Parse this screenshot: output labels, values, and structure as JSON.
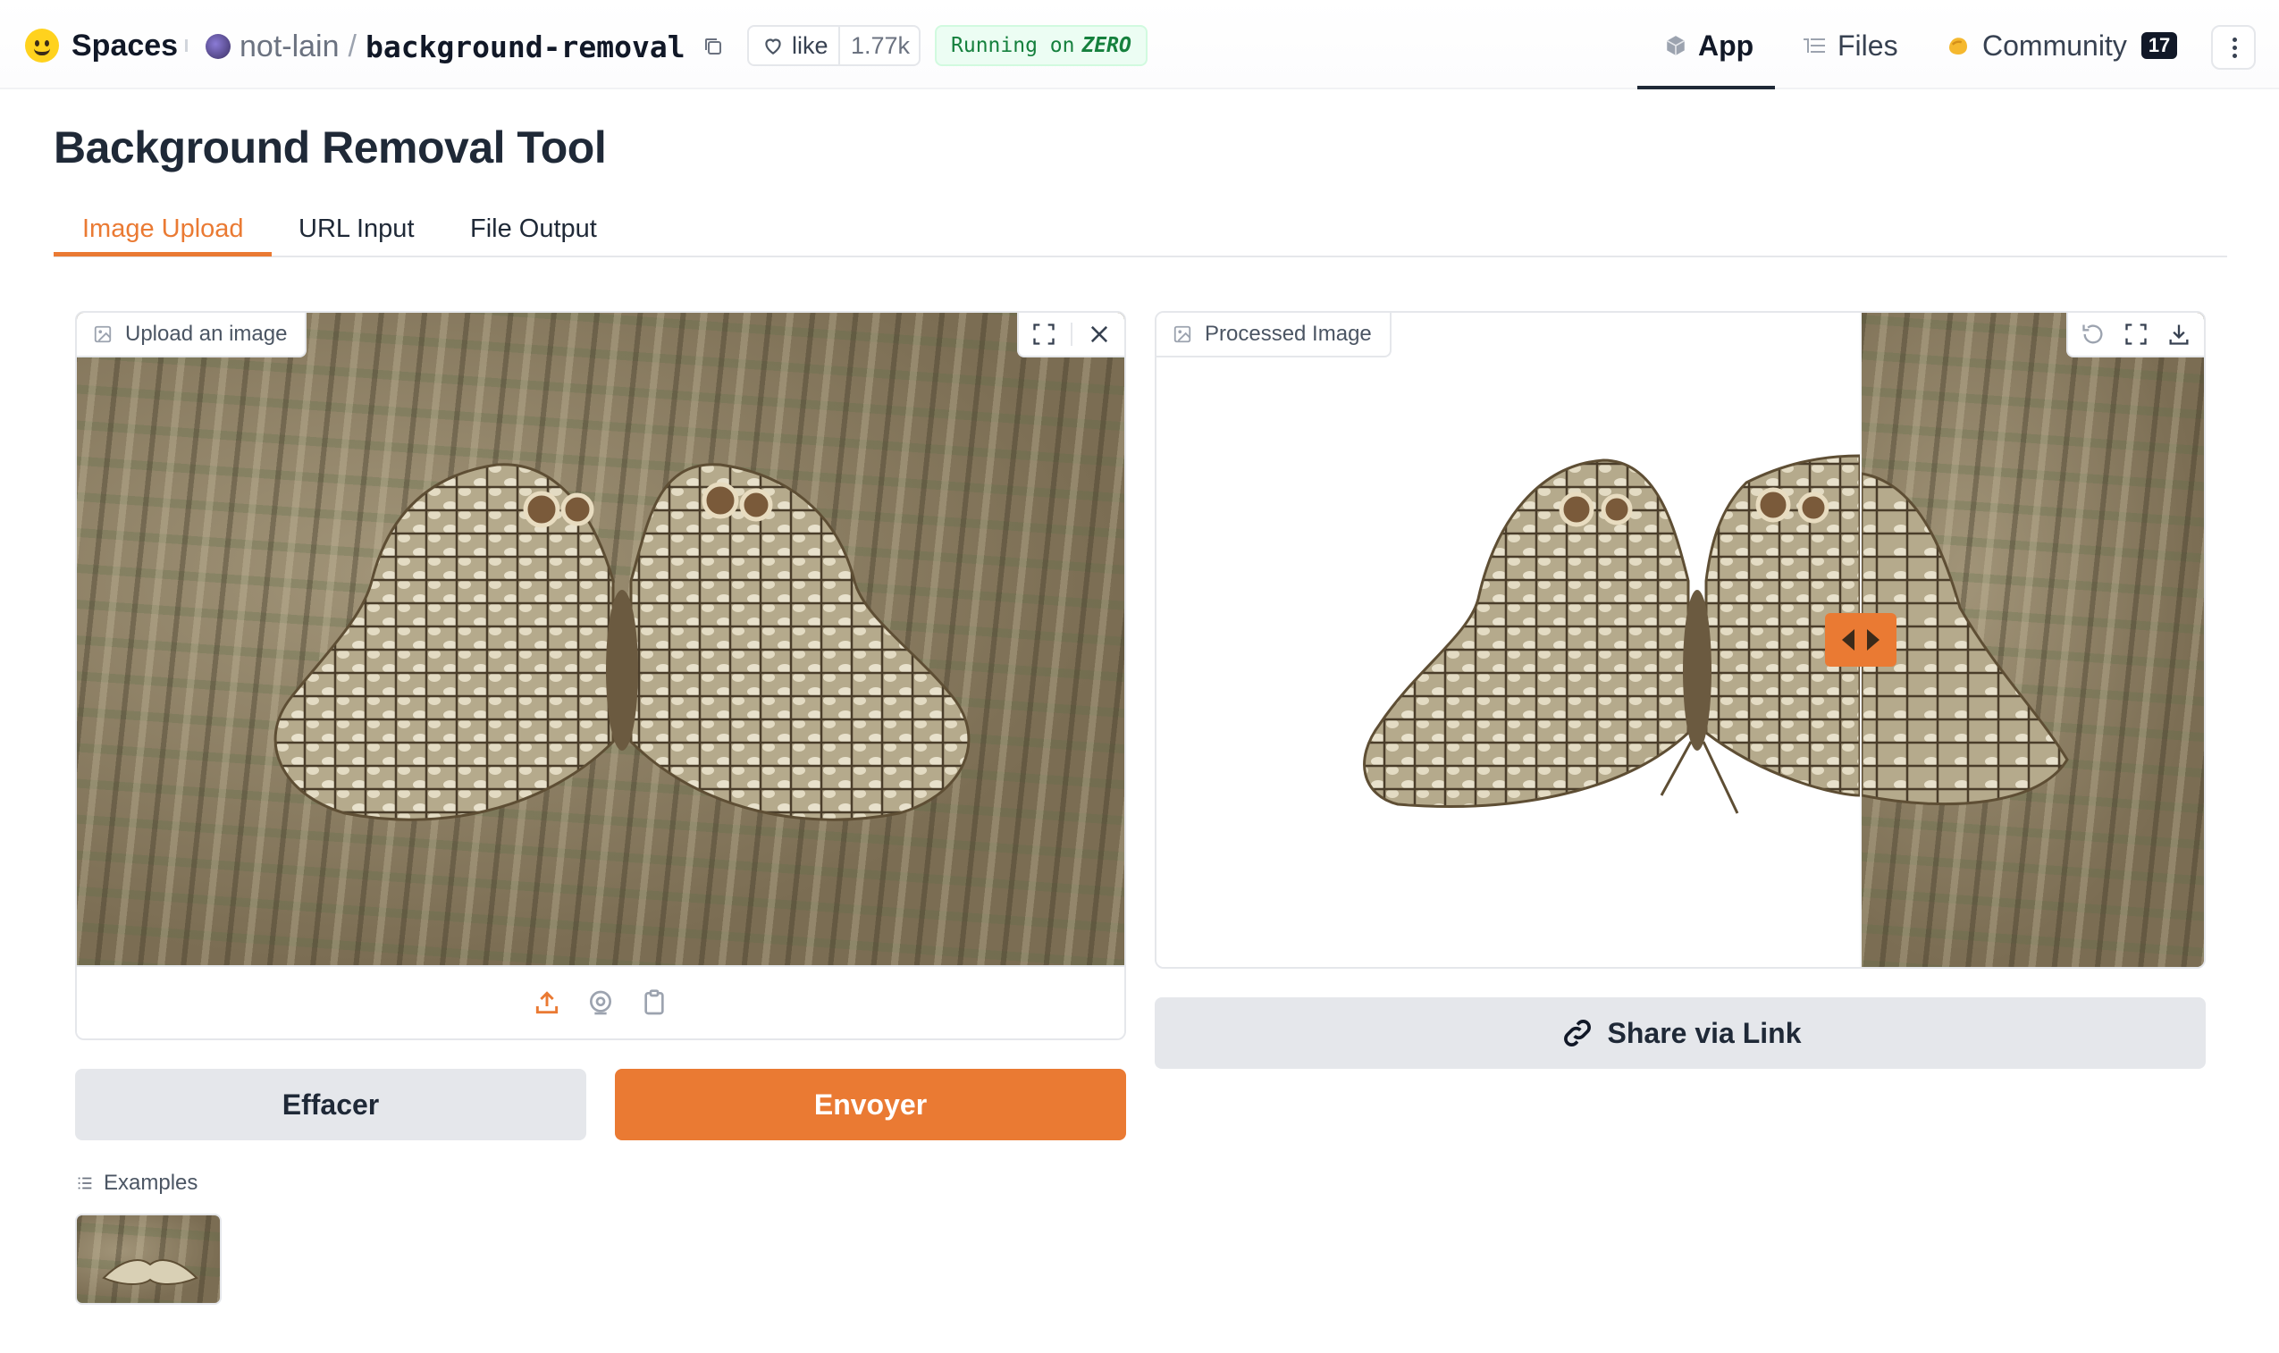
{
  "header": {
    "brand": "Spaces",
    "owner": "not-lain",
    "separator": "/",
    "repo": "background-removal",
    "like_label": "like",
    "like_count": "1.77k",
    "running_prefix": "Running on",
    "running_hardware": "ZERO",
    "nav": {
      "app": "App",
      "files": "Files",
      "community": "Community",
      "community_count": "17"
    }
  },
  "app": {
    "title": "Background Removal Tool",
    "tabs": [
      "Image Upload",
      "URL Input",
      "File Output"
    ],
    "active_tab": "Image Upload",
    "input_panel": {
      "label": "Upload an image"
    },
    "output_panel": {
      "label": "Processed Image"
    },
    "buttons": {
      "clear": "Effacer",
      "submit": "Envoyer",
      "share": "Share via Link"
    },
    "examples": {
      "label": "Examples"
    },
    "slider_position_fraction": 0.67
  },
  "colors": {
    "accent": "#ea7a33",
    "running_bg": "#ecfdf3",
    "running_text": "#15803d",
    "badge_bg": "#111827"
  },
  "icons": [
    "hugging-face-logo",
    "copy-icon",
    "heart-icon",
    "cube-icon",
    "files-icon",
    "community-icon",
    "more-icon",
    "image-icon",
    "fullscreen-icon",
    "close-icon",
    "undo-icon",
    "download-icon",
    "upload-icon",
    "webcam-icon",
    "clipboard-icon",
    "link-icon",
    "list-icon"
  ]
}
